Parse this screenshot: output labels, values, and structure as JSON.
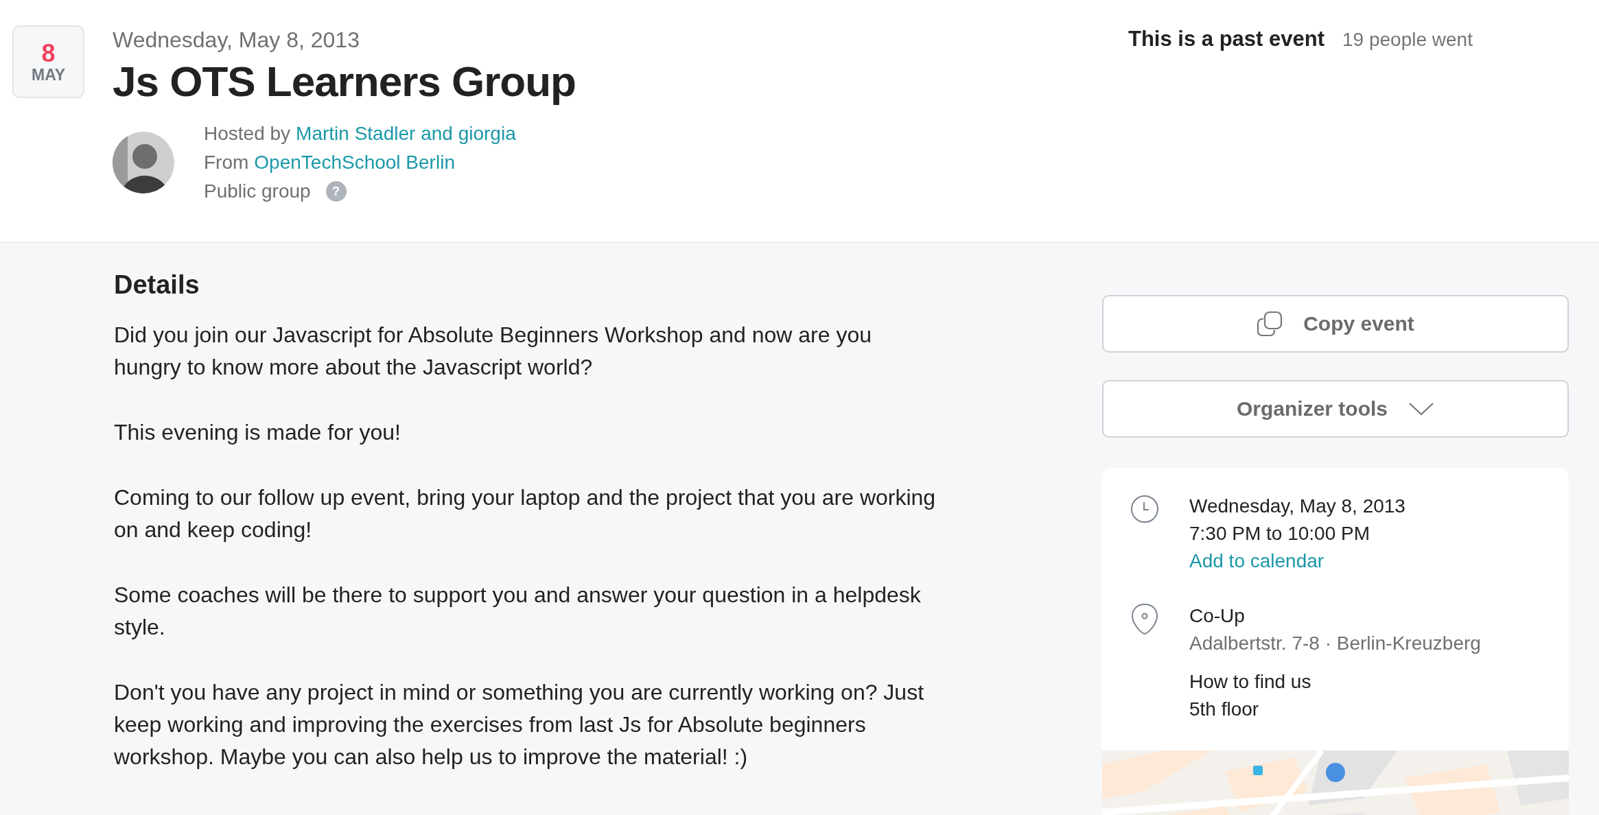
{
  "date_badge": {
    "day": "8",
    "month": "MAY"
  },
  "header": {
    "date": "Wednesday, May 8, 2013",
    "title": "Js OTS Learners Group",
    "hosted_label": "Hosted by",
    "hosts": "Martin Stadler and giorgia",
    "from_label": "From",
    "group": "OpenTechSchool Berlin",
    "visibility": "Public group",
    "help": "?"
  },
  "status": {
    "label": "This is a past event",
    "attendance": "19 people went"
  },
  "details": {
    "heading": "Details",
    "paragraphs": [
      "Did you join our Javascript for Absolute Beginners Workshop and now are you hungry to know more about the Javascript world?",
      "This evening is made for you!",
      "Coming to our follow up event, bring your laptop and the project that you are working on and keep coding!",
      "Some coaches will be there to support you and answer your question in a helpdesk style.",
      "Don't you have any project in mind or something you are currently working on? Just keep working and improving the exercises from last Js for Absolute beginners workshop. Maybe you can also help us to improve the material! :)"
    ]
  },
  "actions": [
    {
      "kind": "copy",
      "label": "Copy event"
    },
    {
      "kind": "dropdown",
      "label": "Organizer tools"
    }
  ],
  "info": {
    "date": "Wednesday, May 8, 2013",
    "time": "7:30 PM to 10:00 PM",
    "calendar_link": "Add to calendar",
    "venue": "Co-Up",
    "address": "Adalbertstr. 7-8 · Berlin-Kreuzberg",
    "directions_label": "How to find us",
    "directions": "5th floor"
  }
}
